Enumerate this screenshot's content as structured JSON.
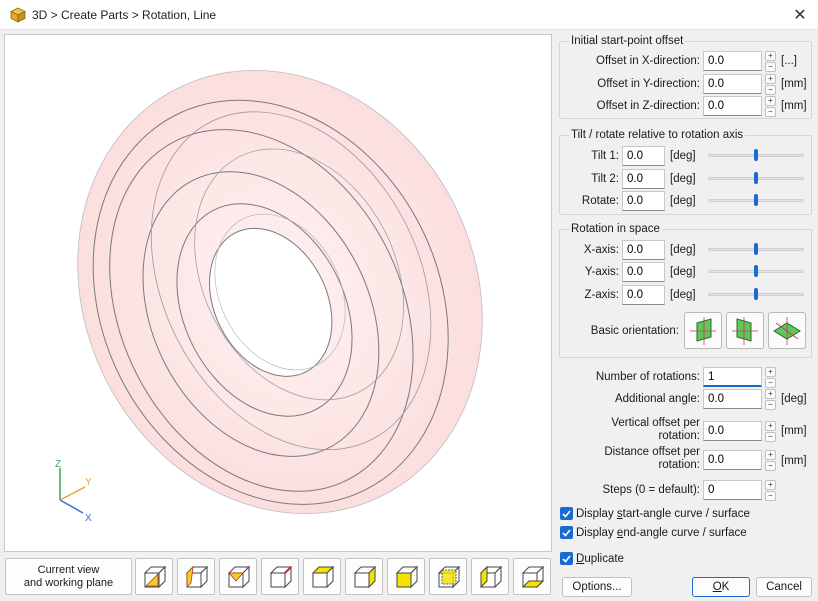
{
  "window": {
    "title": "3D > Create Parts > Rotation, Line",
    "close_label": "✕"
  },
  "viewport": {
    "axes": {
      "z": "Z",
      "y": "Y",
      "x": "X"
    }
  },
  "bottom_toolbar": {
    "current_view_line1": "Current view",
    "current_view_line2": "and working plane"
  },
  "start_offset": {
    "title": "Initial start-point offset",
    "x_label": "Offset in X-direction:",
    "x_value": "0.0",
    "x_unit": "[...]",
    "y_label": "Offset in Y-direction:",
    "y_value": "0.0",
    "y_unit": "[mm]",
    "z_label": "Offset in Z-direction:",
    "z_value": "0.0",
    "z_unit": "[mm]"
  },
  "tilt": {
    "title": "Tilt / rotate relative to rotation axis",
    "tilt1_label": "Tilt 1:",
    "tilt1_value": "0.0",
    "tilt2_label": "Tilt 2:",
    "tilt2_value": "0.0",
    "rotate_label": "Rotate:",
    "rotate_value": "0.0",
    "unit": "[deg]",
    "slider_position": 0.5
  },
  "rotation_space": {
    "title": "Rotation in space",
    "x_label": "X-axis:",
    "x_value": "0.0",
    "y_label": "Y-axis:",
    "y_value": "0.0",
    "z_label": "Z-axis:",
    "z_value": "0.0",
    "unit": "[deg]",
    "basic_orientation_label": "Basic orientation:",
    "slider_position": 0.5
  },
  "params": {
    "num_rotations_label": "Number of rotations:",
    "num_rotations_value": "1",
    "add_angle_label": "Additional angle:",
    "add_angle_value": "0.0",
    "add_angle_unit": "[deg]",
    "vert_offset_label1": "Vertical offset per",
    "vert_offset_label2": "rotation:",
    "vert_offset_value": "0.0",
    "vert_offset_unit": "[mm]",
    "dist_offset_label1": "Distance offset per",
    "dist_offset_label2": "rotation:",
    "dist_offset_value": "0.0",
    "dist_offset_unit": "[mm]",
    "steps_label": "Steps (0 = default):",
    "steps_value": "0"
  },
  "checkboxes": {
    "start_pre": "Display ",
    "start_key": "s",
    "start_post": "tart-angle curve / surface",
    "start_checked": true,
    "end_pre": "Display ",
    "end_key": "e",
    "end_post": "nd-angle curve / surface",
    "end_checked": true,
    "dup_key": "D",
    "dup_post": "uplicate",
    "dup_checked": true
  },
  "buttons": {
    "options": "Options...",
    "ok_key": "O",
    "ok_post": "K",
    "cancel": "Cancel"
  },
  "colors": {
    "accent": "#1a6bd1",
    "torus_fill": "#fbe3e3",
    "torus_stroke": "#6b6b6b"
  }
}
